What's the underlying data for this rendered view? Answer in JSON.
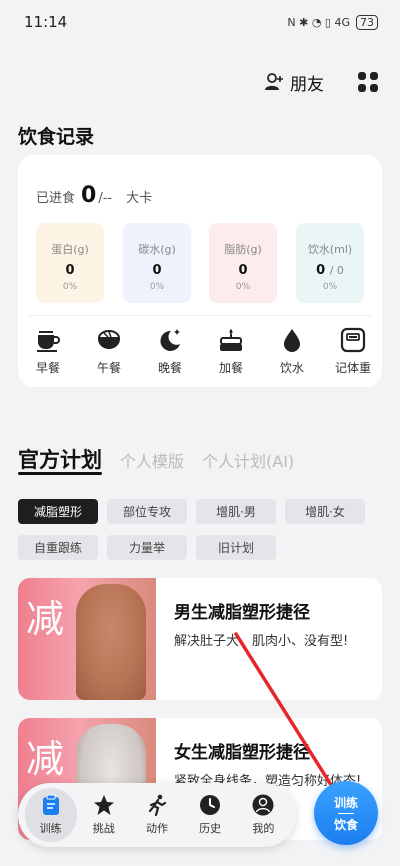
{
  "status_bar": {
    "time": "11:14",
    "icons": "N ✱ ◔ ▯ 4G",
    "battery": "73"
  },
  "header": {
    "friends_label": "朋友",
    "person_icon": "person-plus-icon",
    "menu_icon": "grid-icon"
  },
  "diet_record": {
    "title": "饮食记录",
    "intake_prefix": "已进食",
    "intake_value": "0",
    "intake_sep": "/--",
    "intake_unit": "大卡",
    "nutrients": [
      {
        "label": "蛋白(g)",
        "value": "0",
        "percent": "0%",
        "bg": "#fdf4e6"
      },
      {
        "label": "碳水(g)",
        "value": "0",
        "percent": "0%",
        "bg": "#eef2fc"
      },
      {
        "label": "脂肪(g)",
        "value": "0",
        "percent": "0%",
        "bg": "#fcecec"
      },
      {
        "label": "饮水(ml)",
        "value": "0",
        "value_sub": "/ 0",
        "percent": "0%",
        "bg": "#e9f6f5"
      }
    ],
    "meals": [
      {
        "label": "早餐",
        "icon": "coffee-cup-icon"
      },
      {
        "label": "午餐",
        "icon": "rice-bowl-icon"
      },
      {
        "label": "晚餐",
        "icon": "moon-star-icon"
      },
      {
        "label": "加餐",
        "icon": "cake-icon"
      },
      {
        "label": "饮水",
        "icon": "water-drop-icon"
      },
      {
        "label": "记体重",
        "icon": "scale-icon"
      }
    ]
  },
  "plan_tabs": [
    "官方计划",
    "个人模版",
    "个人计划(AI)"
  ],
  "chips": [
    "减脂塑形",
    "部位专攻",
    "增肌·男",
    "增肌·女",
    "自重跟练",
    "力量举",
    "旧计划"
  ],
  "plans": [
    {
      "image_char": "减",
      "title": "男生减脂塑形捷径",
      "desc": "解决肚子大、肌肉小、没有型!"
    },
    {
      "image_char": "减",
      "title": "女生减脂塑形捷径",
      "desc": "紧致全身线条，塑造匀称好体态!"
    }
  ],
  "bottom_nav": [
    {
      "label": "训练",
      "icon": "clipboard-icon",
      "active": true
    },
    {
      "label": "挑战",
      "icon": "star-icon"
    },
    {
      "label": "动作",
      "icon": "running-person-icon"
    },
    {
      "label": "历史",
      "icon": "clock-icon"
    },
    {
      "label": "我的",
      "icon": "user-icon"
    }
  ],
  "diet_fab": {
    "top": "训练",
    "bottom": "饮食"
  },
  "colors": {
    "accent_blue": "#1c7ef0",
    "arrow_red": "#e8262a"
  }
}
